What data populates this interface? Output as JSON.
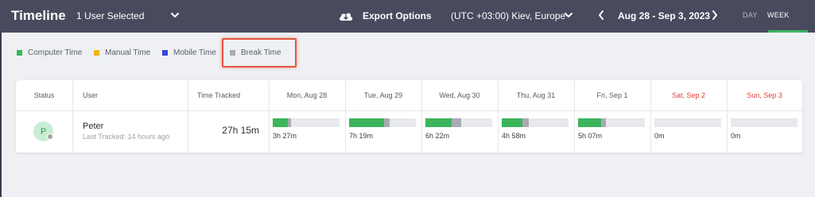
{
  "header": {
    "title": "Timeline",
    "user_select": "1 User Selected",
    "export_label": "Export Options",
    "timezone": "(UTC +03:00) Kiev, Europe",
    "date_range": "Aug 28 - Sep 3, 2023",
    "tabs": {
      "day": "DAY",
      "week": "WEEK"
    },
    "active_tab": "WEEK"
  },
  "legend": [
    {
      "label": "Computer Time",
      "color": "#3bb55c"
    },
    {
      "label": "Manual Time",
      "color": "#f2b321"
    },
    {
      "label": "Mobile Time",
      "color": "#3b45d6"
    },
    {
      "label": "Break Time",
      "color": "#a9aab3"
    }
  ],
  "table": {
    "headers": {
      "status": "Status",
      "user": "User",
      "time_tracked": "Time Tracked"
    },
    "days": [
      {
        "label": "Mon, Aug 28",
        "weekend": false,
        "value": "3h 27m",
        "computer": 0.23,
        "break": 0.05
      },
      {
        "label": "Tue, Aug 29",
        "weekend": false,
        "value": "7h 19m",
        "computer": 0.52,
        "break": 0.08
      },
      {
        "label": "Wed, Aug 30",
        "weekend": false,
        "value": "6h 22m",
        "computer": 0.39,
        "break": 0.14
      },
      {
        "label": "Thu, Aug 31",
        "weekend": false,
        "value": "4h 58m",
        "computer": 0.31,
        "break": 0.09
      },
      {
        "label": "Fri, Sep 1",
        "weekend": false,
        "value": "5h 07m",
        "computer": 0.34,
        "break": 0.07
      },
      {
        "label": "Sat, Sep 2",
        "weekend": true,
        "value": "0m",
        "computer": 0,
        "break": 0
      },
      {
        "label": "Sun, Sep 3",
        "weekend": true,
        "value": "0m",
        "computer": 0,
        "break": 0
      }
    ],
    "row": {
      "avatar_initial": "P",
      "name": "Peter",
      "last_tracked": "Last Tracked: 14 hours ago",
      "time_tracked": "27h 15m"
    }
  },
  "colors": {
    "topbar": "#4a4a5e",
    "accent": "#3ab660",
    "weekend": "#e0403a",
    "highlight": "#e5533d",
    "computer": "#3bb55c",
    "break": "#a9aab3"
  }
}
